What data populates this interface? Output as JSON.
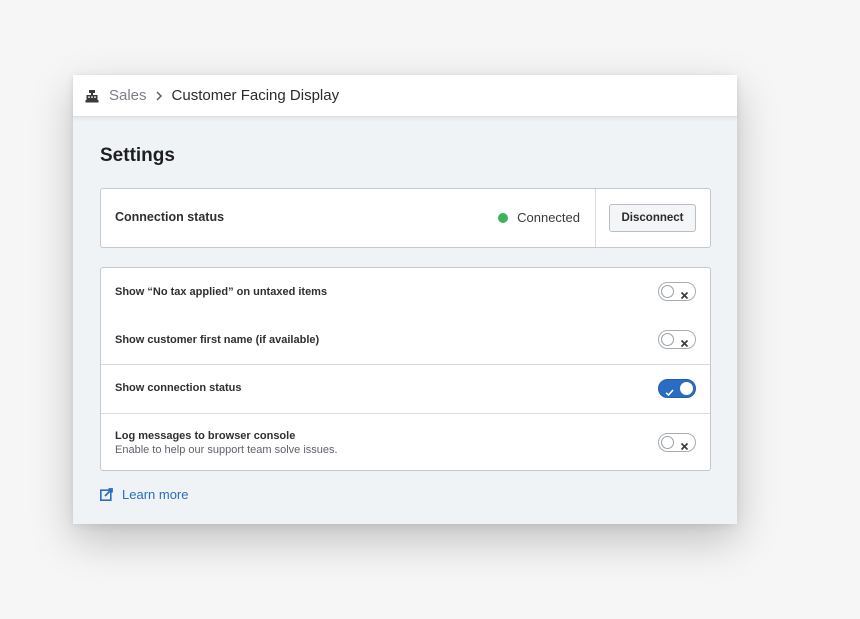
{
  "breadcrumb": {
    "parent": "Sales",
    "current": "Customer Facing Display"
  },
  "page": {
    "title": "Settings"
  },
  "connection": {
    "label": "Connection status",
    "status": "Connected",
    "status_color": "#3cb45a",
    "button_label": "Disconnect"
  },
  "settings": [
    {
      "label": "Show “No tax applied” on untaxed items",
      "enabled": false
    },
    {
      "label": "Show customer first name (if available)",
      "enabled": false
    },
    {
      "label": "Show connection status",
      "enabled": true
    },
    {
      "label": "Log messages to browser console",
      "description": "Enable to help our support team solve issues.",
      "enabled": false
    }
  ],
  "learn_more": {
    "label": "Learn more"
  },
  "colors": {
    "accent": "#2a6cc2",
    "status_connected": "#3cb45a"
  },
  "icons": {
    "breadcrumb_root": "cash-register-icon",
    "separator": "chevron-right-icon",
    "learn_more": "external-edit-icon"
  }
}
